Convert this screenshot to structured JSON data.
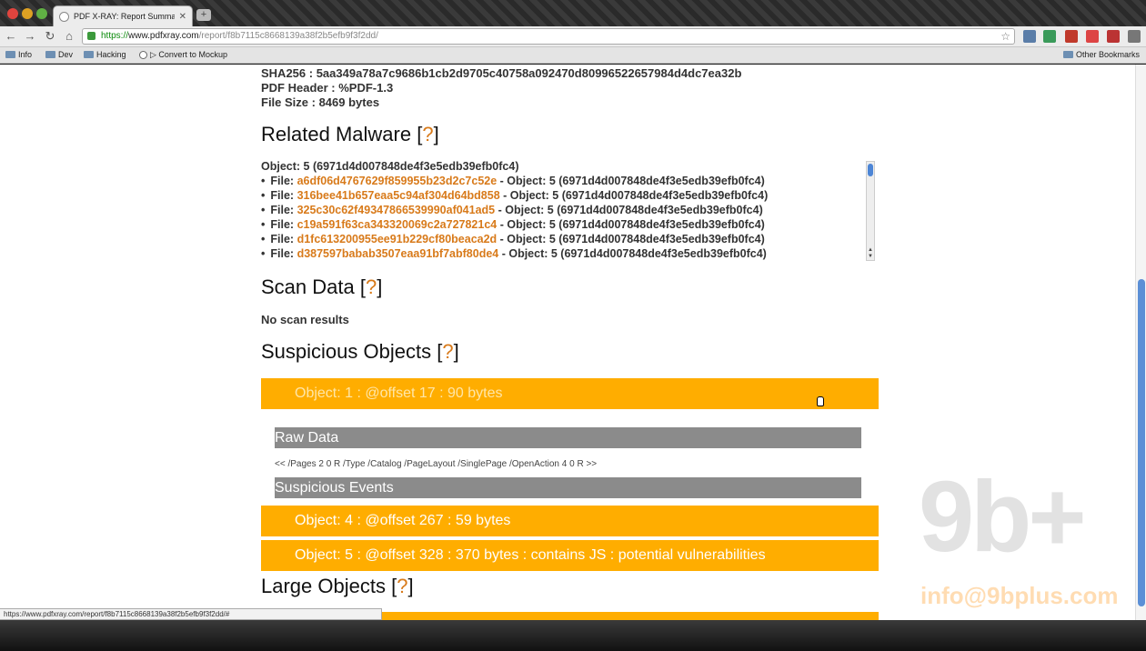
{
  "browser": {
    "tab_title": "PDF X-RAY: Report Summary",
    "tab_close": "✕",
    "new_tab": "+",
    "url_scheme": "https://",
    "url_host": "www.pdfxray.com",
    "url_path": "/report/f8b7115c8668139a38f2b5efb9f3f2dd/",
    "bookmarks": [
      {
        "label": "Info"
      },
      {
        "label": "Dev"
      },
      {
        "label": "Hacking"
      },
      {
        "label": "▷ Convert to Mockup"
      }
    ],
    "other_bookmarks": "Other Bookmarks",
    "status_url": "https://www.pdfxray.com/report/f8b7115c8668139a38f2b5efb9f3f2dd/#"
  },
  "file_info": {
    "sha256": "SHA256 : 5aa349a78a7c9686b1cb2d9705c40758a092470d80996522657984d4dc7ea32b",
    "pdf_header": "PDF Header : %PDF-1.3",
    "file_size": "File Size : 8469 bytes"
  },
  "sections": {
    "related_malware": "Related Malware [",
    "scan_data": "Scan Data [",
    "suspicious_objects": "Suspicious Objects [",
    "large_objects": "Large Objects [",
    "help_mark": "?",
    "close_bracket": "]"
  },
  "related": {
    "object_header": "Object: 5 (6971d4d007848de4f3e5edb39efb0fc4)",
    "file_prefix": "File: ",
    "items": [
      {
        "hash": "a6df06d4767629f859955b23d2c7c52e",
        "suffix": " - Object: 5 (6971d4d007848de4f3e5edb39efb0fc4)"
      },
      {
        "hash": "316bee41b657eaa5c94af304d64bd858",
        "suffix": " - Object: 5 (6971d4d007848de4f3e5edb39efb0fc4)"
      },
      {
        "hash": "325c30c62f49347866539990af041ad5",
        "suffix": " - Object: 5 (6971d4d007848de4f3e5edb39efb0fc4)"
      },
      {
        "hash": "c19a591f63ca343320069c2a727821c4",
        "suffix": " - Object: 5 (6971d4d007848de4f3e5edb39efb0fc4)"
      },
      {
        "hash": "d1fc613200955ee91b229cf80beaca2d",
        "suffix": " - Object: 5 (6971d4d007848de4f3e5edb39efb0fc4)"
      },
      {
        "hash": "d387597babab3507eaa91bf7abf80de4",
        "suffix": " - Object: 5 (6971d4d007848de4f3e5edb39efb0fc4)"
      }
    ]
  },
  "scan": {
    "result": "No scan results"
  },
  "objects": {
    "object1": "Object: 1 : @offset 17 : 90 bytes",
    "raw_data_label": "Raw Data",
    "raw_data_content": "<< /Pages 2 0 R /Type /Catalog /PageLayout /SinglePage /OpenAction 4 0 R >>",
    "suspicious_events_label": "Suspicious Events",
    "object4": "Object: 4 : @offset 267 : 59 bytes",
    "object5": "Object: 5 : @offset 328 : 370 bytes : contains JS : potential vulnerabilities"
  },
  "watermark": {
    "logo": "9b+",
    "email": "info@9bplus.com"
  },
  "colors": {
    "accent_orange": "#ffad00",
    "link_orange": "#d87a1a",
    "gray_bar": "#8b8b8b"
  },
  "icons": {
    "back": "←",
    "forward": "→",
    "reload": "↻",
    "home": "⌂",
    "star": "☆",
    "scroll_up": "▲",
    "scroll_down": "▼"
  }
}
